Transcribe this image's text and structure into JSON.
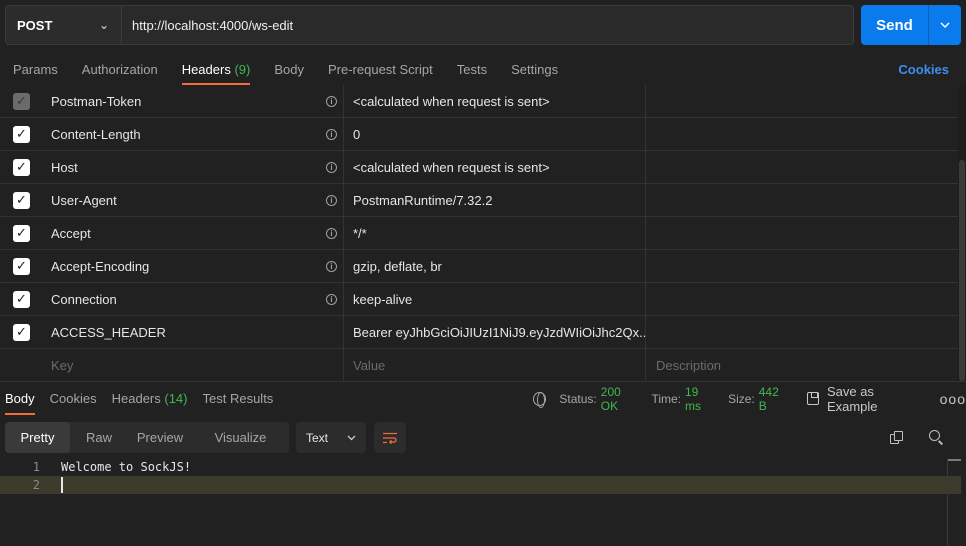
{
  "request": {
    "method": "POST",
    "url": "http://localhost:4000/ws-edit",
    "send_label": "Send"
  },
  "request_tabs": [
    {
      "label": "Params"
    },
    {
      "label": "Authorization"
    },
    {
      "label": "Headers",
      "count": "(9)"
    },
    {
      "label": "Body"
    },
    {
      "label": "Pre-request Script"
    },
    {
      "label": "Tests"
    },
    {
      "label": "Settings"
    }
  ],
  "cookies_link": "Cookies",
  "headers": [
    {
      "key": "Postman-Token",
      "value": "<calculated when request is sent>",
      "checked": true,
      "disabled": true,
      "info": true
    },
    {
      "key": "Content-Length",
      "value": "0",
      "checked": true,
      "disabled": false,
      "info": true
    },
    {
      "key": "Host",
      "value": "<calculated when request is sent>",
      "checked": true,
      "disabled": false,
      "info": true
    },
    {
      "key": "User-Agent",
      "value": "PostmanRuntime/7.32.2",
      "checked": true,
      "disabled": false,
      "info": true
    },
    {
      "key": "Accept",
      "value": "*/*",
      "checked": true,
      "disabled": false,
      "info": true
    },
    {
      "key": "Accept-Encoding",
      "value": "gzip, deflate, br",
      "checked": true,
      "disabled": false,
      "info": true
    },
    {
      "key": "Connection",
      "value": "keep-alive",
      "checked": true,
      "disabled": false,
      "info": true
    },
    {
      "key": "ACCESS_HEADER",
      "value": "Bearer eyJhbGciOiJIUzI1NiJ9.eyJzdWIiOiJhc2Qx...",
      "checked": true,
      "disabled": false,
      "info": false
    }
  ],
  "header_placeholders": {
    "key": "Key",
    "value": "Value",
    "description": "Description"
  },
  "response_tabs": [
    {
      "label": "Body"
    },
    {
      "label": "Cookies"
    },
    {
      "label": "Headers",
      "count": "(14)"
    },
    {
      "label": "Test Results"
    }
  ],
  "response_status": {
    "status_label": "Status:",
    "status_value": "200 OK",
    "time_label": "Time:",
    "time_value": "19 ms",
    "size_label": "Size:",
    "size_value": "442 B",
    "save_label": "Save as Example",
    "more": "ooo"
  },
  "format": {
    "modes": [
      "Pretty",
      "Raw",
      "Preview",
      "Visualize"
    ],
    "language": "Text"
  },
  "editor_lines": [
    {
      "num": "1",
      "text": "Welcome to SockJS!"
    },
    {
      "num": "2",
      "text": ""
    }
  ],
  "colors": {
    "accent": "#f26b3a",
    "send": "#097bed",
    "success": "#3fb950",
    "link": "#3d8ef0"
  }
}
